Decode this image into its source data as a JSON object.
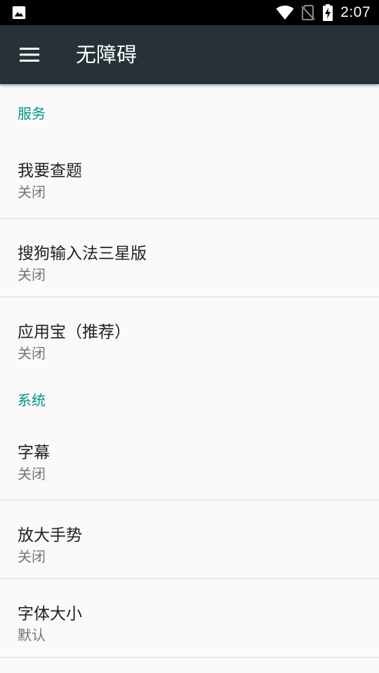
{
  "status_bar": {
    "time": "2:07",
    "icons": [
      "image-notification-icon",
      "wifi-icon",
      "no-sim-icon",
      "battery-charging-icon"
    ]
  },
  "toolbar": {
    "title": "无障碍",
    "menu_icon": "hamburger-menu-icon",
    "background": "#263238"
  },
  "accent_color": "#009688",
  "sections": [
    {
      "header": "服务",
      "items": [
        {
          "title": "我要查题",
          "summary": "关闭"
        },
        {
          "title": "搜狗输入法三星版",
          "summary": "关闭"
        },
        {
          "title": "应用宝（推荐）",
          "summary": "关闭"
        }
      ]
    },
    {
      "header": "系统",
      "items": [
        {
          "title": "字幕",
          "summary": "关闭"
        },
        {
          "title": "放大手势",
          "summary": "关闭"
        },
        {
          "title": "字体大小",
          "summary": "默认"
        }
      ]
    }
  ]
}
